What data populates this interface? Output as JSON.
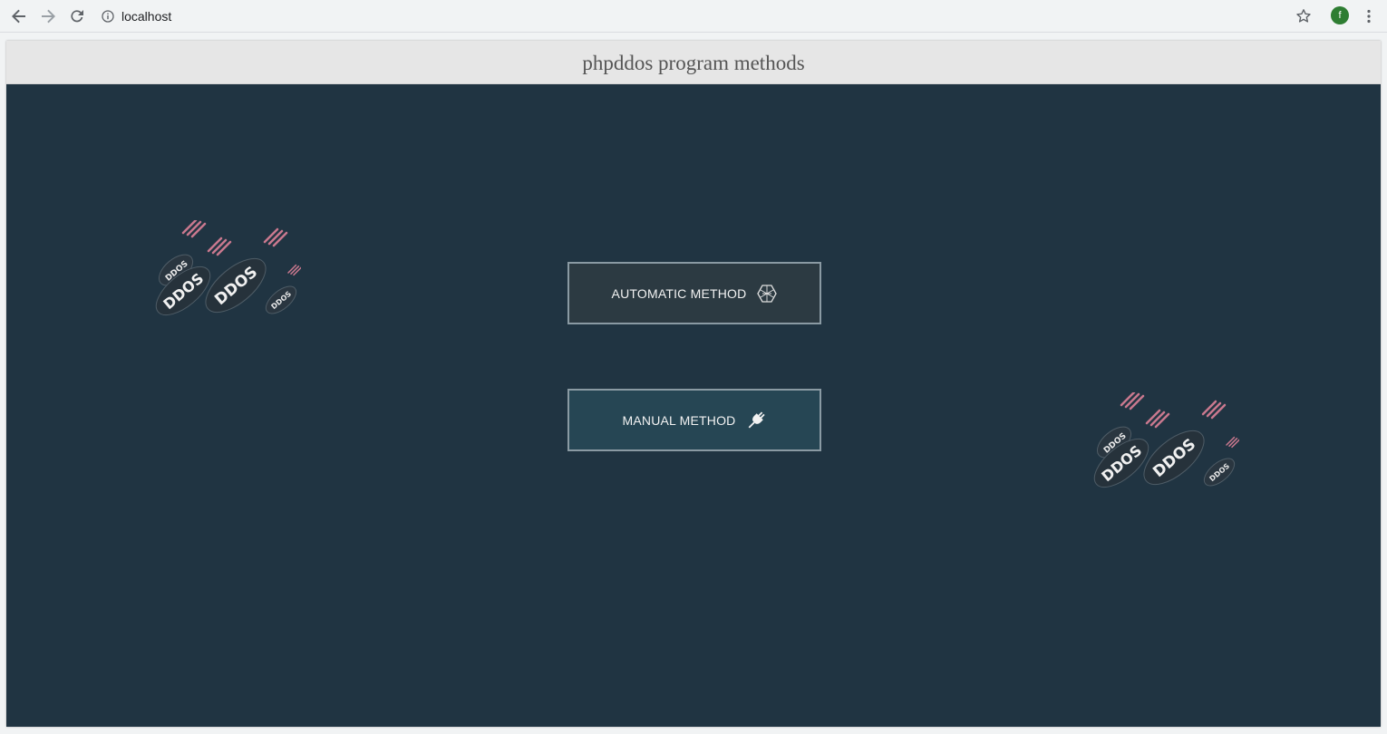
{
  "browser": {
    "url": "localhost",
    "profile_initial": "f",
    "icons": {
      "back": "arrow-left-icon",
      "forward": "arrow-right-icon",
      "reload": "reload-icon",
      "info": "info-icon",
      "bookmark": "star-icon",
      "menu": "more-vertical-icon"
    }
  },
  "page": {
    "title": "phpddos program methods",
    "background": "#203442",
    "buttons": {
      "automatic_label": "AUTOMATIC METHOD",
      "automatic_icon": "hexagon-globe-icon",
      "manual_label": "MANUAL METHOD",
      "manual_icon": "plug-icon"
    },
    "decorations": {
      "bomb_label": "DDOS"
    }
  }
}
